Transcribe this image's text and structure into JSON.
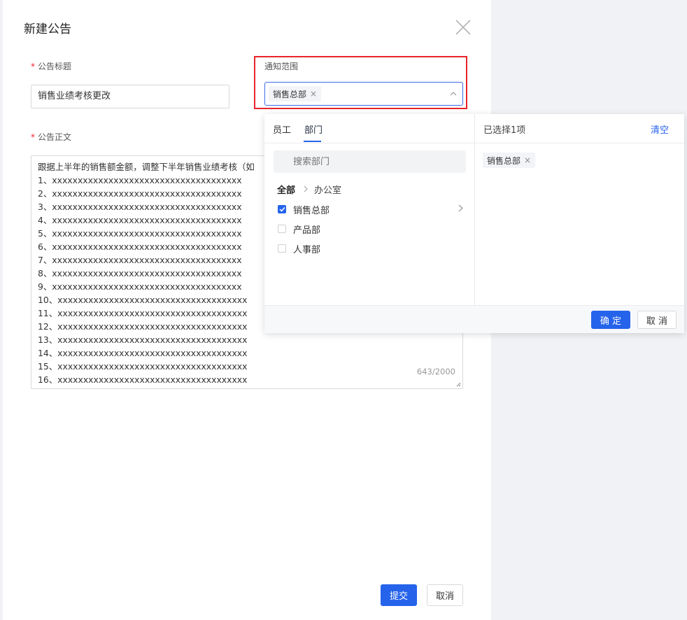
{
  "drawer": {
    "title": "新建公告"
  },
  "form": {
    "title_label": "公告标题",
    "title_value": "销售业绩考核更改",
    "scope_label": "通知范围",
    "scope_tag": "销售总部",
    "body_label": "公告正文",
    "body_lines": [
      "跟据上半年的销售额金额，调整下半年销售业绩考核（如",
      "1、xxxxxxxxxxxxxxxxxxxxxxxxxxxxxxxxxxxxx",
      "2、xxxxxxxxxxxxxxxxxxxxxxxxxxxxxxxxxxxxx",
      "3、xxxxxxxxxxxxxxxxxxxxxxxxxxxxxxxxxxxxx",
      "4、xxxxxxxxxxxxxxxxxxxxxxxxxxxxxxxxxxxxx",
      "5、xxxxxxxxxxxxxxxxxxxxxxxxxxxxxxxxxxxxx",
      "6、xxxxxxxxxxxxxxxxxxxxxxxxxxxxxxxxxxxxx",
      "7、xxxxxxxxxxxxxxxxxxxxxxxxxxxxxxxxxxxxx",
      "8、xxxxxxxxxxxxxxxxxxxxxxxxxxxxxxxxxxxxx",
      "9、xxxxxxxxxxxxxxxxxxxxxxxxxxxxxxxxxxxxx",
      "10、xxxxxxxxxxxxxxxxxxxxxxxxxxxxxxxxxxxxx",
      "11、xxxxxxxxxxxxxxxxxxxxxxxxxxxxxxxxxxxxx",
      "12、xxxxxxxxxxxxxxxxxxxxxxxxxxxxxxxxxxxxx",
      "13、xxxxxxxxxxxxxxxxxxxxxxxxxxxxxxxxxxxxx",
      "14、xxxxxxxxxxxxxxxxxxxxxxxxxxxxxxxxxxxxx",
      "15、xxxxxxxxxxxxxxxxxxxxxxxxxxxxxxxxxxxxx",
      "16、xxxxxxxxxxxxxxxxxxxxxxxxxxxxxxxxxxxxx"
    ],
    "char_count": "643/2000",
    "submit_label": "提交",
    "cancel_label": "取消"
  },
  "picker": {
    "tab_employee": "员工",
    "tab_department": "部门",
    "search_placeholder": "搜索部门",
    "crumb_all": "全部",
    "crumb_current": "办公室",
    "departments": [
      {
        "label": "销售总部",
        "checked": true
      },
      {
        "label": "产品部",
        "checked": false
      },
      {
        "label": "人事部",
        "checked": false
      }
    ],
    "selected_count_label": "已选择1项",
    "clear_label": "清空",
    "selected_tag": "销售总部",
    "confirm_label": "确 定",
    "cancel_label": "取 消"
  },
  "colors": {
    "primary": "#2563eb",
    "highlight": "#e8242b",
    "required": "#f5222d"
  }
}
